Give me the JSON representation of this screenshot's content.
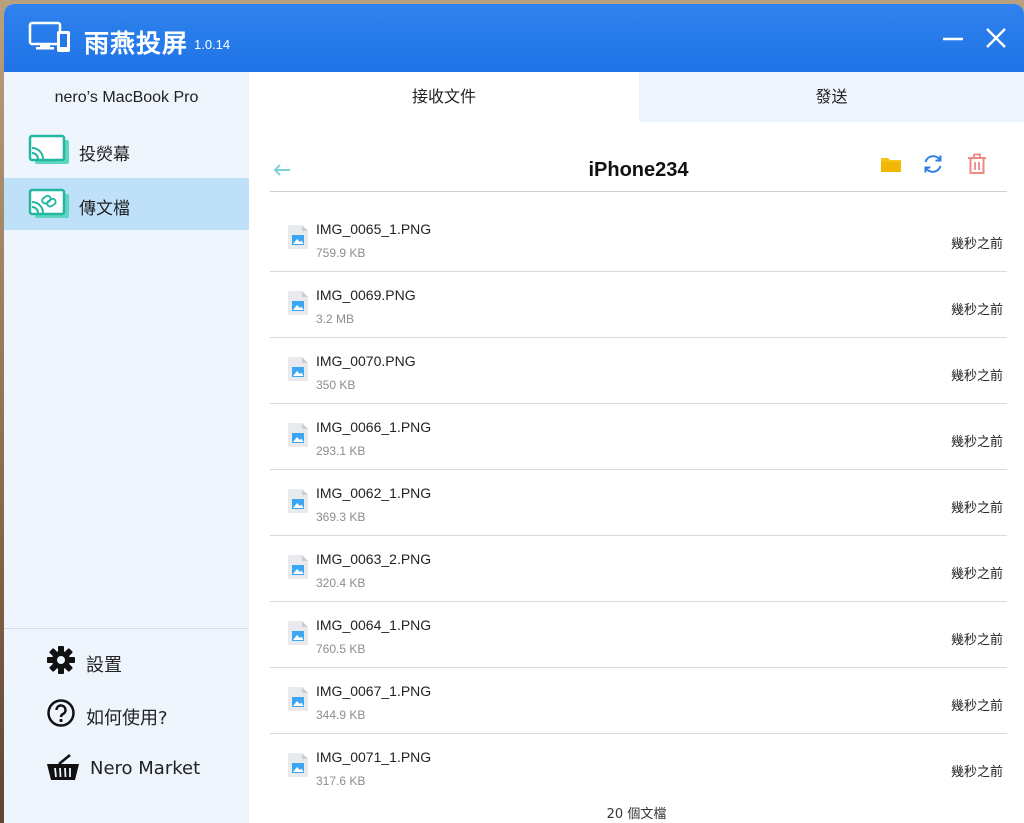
{
  "titlebar": {
    "title": "雨燕投屏",
    "version": "1.0.14",
    "color": "#2479ea"
  },
  "sidebar": {
    "device_name": "nero’s MacBook Pro",
    "nav": [
      {
        "label": "投熒幕",
        "icon": "screen-cast-icon",
        "active": false
      },
      {
        "label": "傳文檔",
        "icon": "file-transfer-icon",
        "active": true
      }
    ],
    "bottom": [
      {
        "label": "設置",
        "icon": "gear-icon"
      },
      {
        "label": "如何使用?",
        "icon": "help-icon"
      },
      {
        "label": "Nero Market",
        "icon": "basket-icon"
      }
    ]
  },
  "tabs": {
    "receive": "接收文件",
    "send": "發送",
    "active": "receive"
  },
  "folder": {
    "title": "iPhone234",
    "files": [
      {
        "name": "IMG_0065_1.PNG",
        "size": "759.9 KB",
        "time": "幾秒之前"
      },
      {
        "name": "IMG_0069.PNG",
        "size": "3.2 MB",
        "time": "幾秒之前"
      },
      {
        "name": "IMG_0070.PNG",
        "size": "350 KB",
        "time": "幾秒之前"
      },
      {
        "name": "IMG_0066_1.PNG",
        "size": "293.1 KB",
        "time": "幾秒之前"
      },
      {
        "name": "IMG_0062_1.PNG",
        "size": "369.3 KB",
        "time": "幾秒之前"
      },
      {
        "name": "IMG_0063_2.PNG",
        "size": "320.4 KB",
        "time": "幾秒之前"
      },
      {
        "name": "IMG_0064_1.PNG",
        "size": "760.5 KB",
        "time": "幾秒之前"
      },
      {
        "name": "IMG_0067_1.PNG",
        "size": "344.9 KB",
        "time": "幾秒之前"
      },
      {
        "name": "IMG_0071_1.PNG",
        "size": "317.6 KB",
        "time": "幾秒之前"
      }
    ],
    "count_label": "20 個文檔"
  },
  "colors": {
    "accent": "#2479ea",
    "folder": "#f5c518",
    "refresh": "#2a7fe0",
    "delete": "#ef8a80",
    "active_nav": "#bfe0f9"
  }
}
